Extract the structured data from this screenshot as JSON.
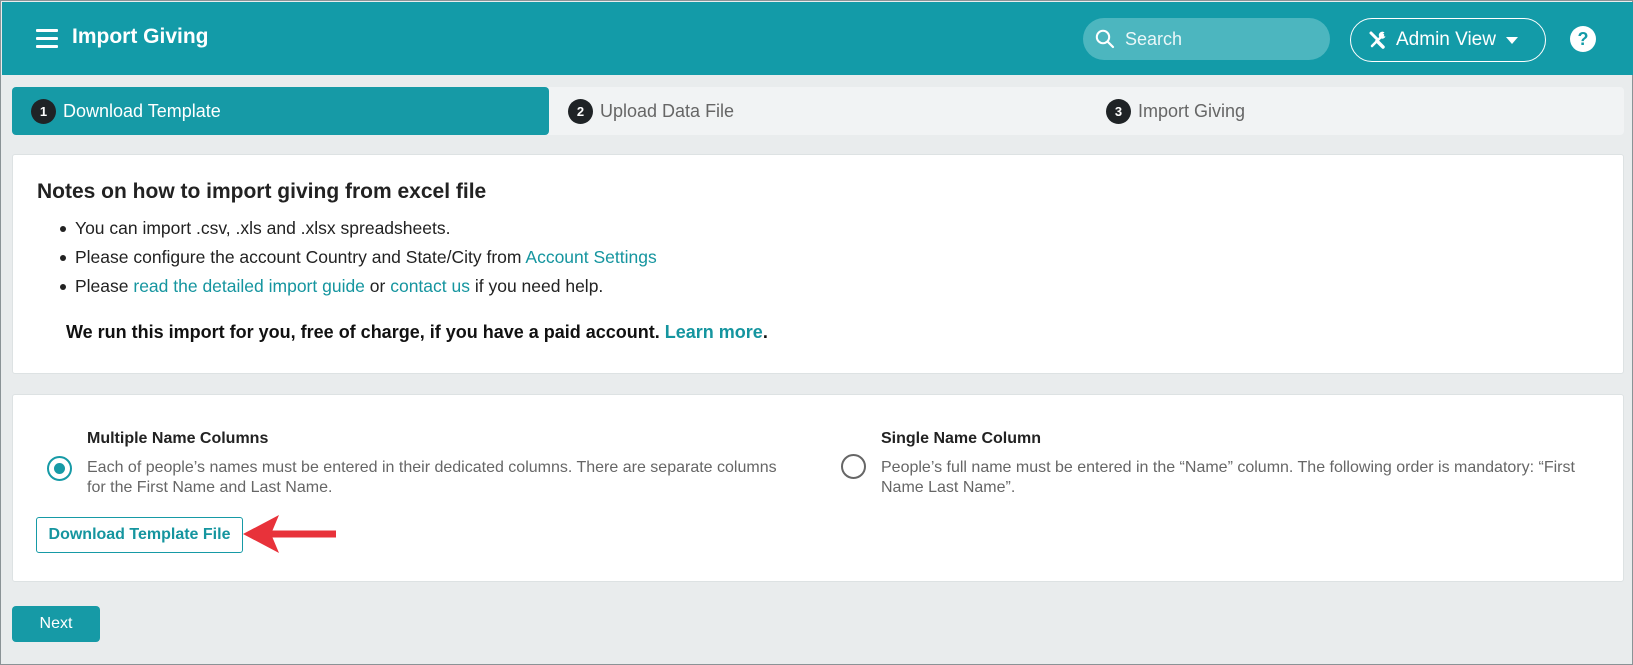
{
  "header": {
    "title": "Import Giving",
    "search_placeholder": "Search",
    "admin_view_label": "Admin View",
    "help_label": "?"
  },
  "steps": [
    {
      "num": "1",
      "label": "Download Template",
      "active": true
    },
    {
      "num": "2",
      "label": "Upload Data File",
      "active": false
    },
    {
      "num": "3",
      "label": "Import Giving",
      "active": false
    }
  ],
  "notes": {
    "title": "Notes on how to import giving from excel file",
    "item1": "You can import .csv, .xls and .xlsx spreadsheets.",
    "item2_text": "Please configure the account Country and State/City from ",
    "item2_link": "Account Settings",
    "item3_prefix": "Please ",
    "item3_link1": "read the detailed import guide",
    "item3_mid": " or ",
    "item3_link2": "contact us",
    "item3_suffix": " if you need help.",
    "paid_text": "We run this import for you, free of charge, if you have a paid account. ",
    "paid_link": "Learn more",
    "paid_end": "."
  },
  "template": {
    "option_multiple": {
      "title": "Multiple Name Columns",
      "desc": "Each of people’s names must be entered in their dedicated columns. There are separate columns for the First Name and Last Name.",
      "selected": true
    },
    "option_single": {
      "title": "Single Name Column",
      "desc": "People’s full name must be entered in the “Name” column. The following order is mandatory: “First Name Last Name”.",
      "selected": false
    },
    "download_button": "Download Template File"
  },
  "footer": {
    "next_button": "Next"
  },
  "colors": {
    "header": "#139ba8",
    "accent": "#169aa6",
    "annotation_arrow": "#e8323a"
  }
}
